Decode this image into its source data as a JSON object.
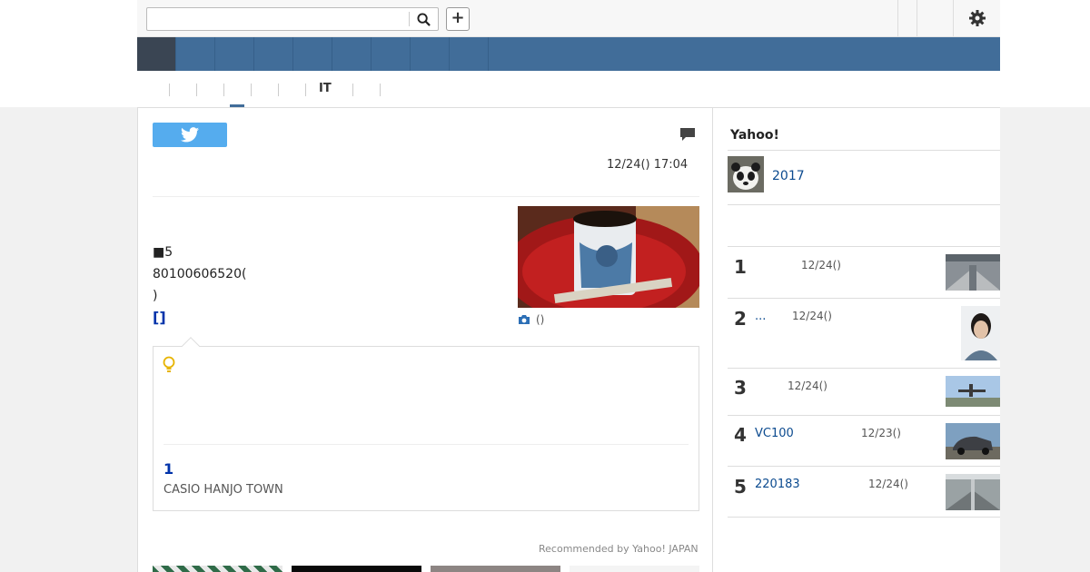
{
  "search": {
    "value": "",
    "placeholder": ""
  },
  "header": {
    "plus_label": "+"
  },
  "subnav": {
    "it_label": "IT"
  },
  "article": {
    "date": "12/24() 17:04",
    "body_line1": "■5",
    "body_line2": "80100606520(",
    "body_line3": ")",
    "link": "[]",
    "photo_caption": "()"
  },
  "tip": {
    "count": "1",
    "org": "CASIO HANJO TOWN"
  },
  "recommended": "Recommended by Yahoo! JAPAN",
  "sidebar": {
    "heading": "Yahoo!",
    "featured": "2017",
    "ranking": [
      {
        "rank": "1",
        "title": "",
        "date": "12/24()"
      },
      {
        "rank": "2",
        "title": "...",
        "date": "12/24()"
      },
      {
        "rank": "3",
        "title": "",
        "date": "12/24()"
      },
      {
        "rank": "4",
        "title": "VC100",
        "date": "12/23()"
      },
      {
        "rank": "5",
        "title": "220183",
        "date": "12/24()"
      }
    ]
  },
  "colors": {
    "nav": "#416d99",
    "nav_active": "#3a4553",
    "twitter": "#55acee",
    "link": "#0033aa"
  },
  "icons": [
    "search-icon",
    "plus-icon",
    "gear-icon",
    "twitter-icon",
    "comment-icon",
    "camera-icon",
    "lightbulb-icon"
  ]
}
